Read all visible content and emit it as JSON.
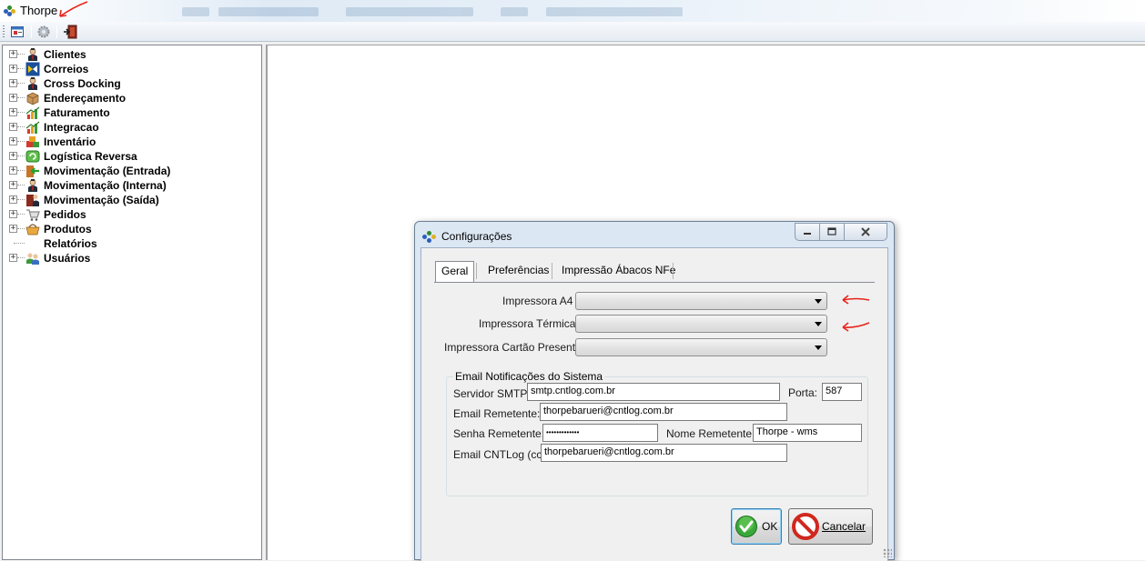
{
  "window": {
    "title": "Thorpe"
  },
  "toolbar": {
    "buttons": [
      {
        "icon": "window-list-icon"
      },
      {
        "icon": "settings-gear-icon"
      },
      {
        "icon": "exit-door-icon"
      }
    ]
  },
  "tree": {
    "items": [
      {
        "label": "Clientes",
        "icon": "user-icon",
        "expandable": true
      },
      {
        "label": "Correios",
        "icon": "mail-logo-icon",
        "expandable": true
      },
      {
        "label": "Cross Docking",
        "icon": "user-icon",
        "expandable": true
      },
      {
        "label": "Endereçamento",
        "icon": "box-icon",
        "expandable": true
      },
      {
        "label": "Faturamento",
        "icon": "chart-icon",
        "expandable": true
      },
      {
        "label": "Integracao",
        "icon": "chart-icon",
        "expandable": true
      },
      {
        "label": "Inventário",
        "icon": "boxes-icon",
        "expandable": true
      },
      {
        "label": "Logística Reversa",
        "icon": "recycle-icon",
        "expandable": true
      },
      {
        "label": "Movimentação (Entrada)",
        "icon": "arrow-in-icon",
        "expandable": true
      },
      {
        "label": "Movimentação (Interna)",
        "icon": "user-icon",
        "expandable": true
      },
      {
        "label": "Movimentação (Saída)",
        "icon": "user-exit-icon",
        "expandable": true
      },
      {
        "label": "Pedidos",
        "icon": "cart-icon",
        "expandable": true
      },
      {
        "label": "Produtos",
        "icon": "basket-icon",
        "expandable": true
      },
      {
        "label": "Relatórios",
        "icon": "",
        "expandable": false
      },
      {
        "label": "Usuários",
        "icon": "users-icon",
        "expandable": true
      }
    ]
  },
  "dialog": {
    "title": "Configurações",
    "tabs": [
      "Geral",
      "Preferências",
      "Impressão Ábacos NFe"
    ],
    "active_tab": "Geral",
    "printers": {
      "a4_label": "Impressora A4",
      "a4_value": "",
      "thermal_label": "Impressora Térmica",
      "thermal_value": "",
      "giftcard_label": "Impressora Cartão Presente",
      "giftcard_value": ""
    },
    "email": {
      "group_title": "Email Notificações do Sistema",
      "smtp_label": "Servidor SMTP:",
      "smtp_value": "smtp.cntlog.com.br",
      "port_label": "Porta:",
      "port_value": "587",
      "sender_label": "Email Remetente:",
      "sender_value": "thorpebarueri@cntlog.com.br",
      "password_label": "Senha Remetente:",
      "password_value": "•••••••••••••",
      "name_label": "Nome Remetente:",
      "name_value": "Thorpe - wms",
      "cc_label": "Email CNTLog (cc):",
      "cc_value": "thorpebarueri@cntlog.com.br"
    },
    "buttons": {
      "ok": "OK",
      "cancel": "Cancelar"
    }
  },
  "colors": {
    "annotation_red": "#e8241c",
    "dialog_frame": "#dce7f4",
    "ok_green": "#3aa83a",
    "cancel_red": "#d0281e"
  }
}
